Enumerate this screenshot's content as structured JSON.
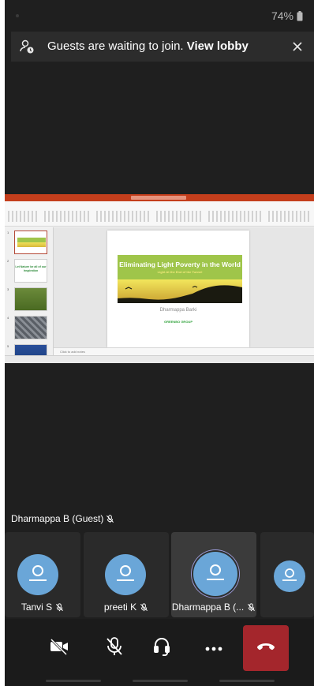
{
  "status_bar": {
    "battery_percent": "74%",
    "icons": [
      "battery-icon"
    ]
  },
  "lobby_banner": {
    "message": "Guests are waiting to join.",
    "link_label": "View lobby",
    "icons": [
      "guest-waiting-icon",
      "close-icon"
    ]
  },
  "shared_screen": {
    "app": "PowerPoint",
    "slide": {
      "title": "Eliminating Light Poverty in the World",
      "subtitle": "Light At the End of the Tunnel",
      "author": "Dharmappa Barki",
      "organization": "GREENBO GROUP"
    },
    "thumbnails": [
      {
        "number": "1"
      },
      {
        "number": "2",
        "text": "Let Nature be all of our Inspiration"
      },
      {
        "number": "3"
      },
      {
        "number": "4"
      },
      {
        "number": "5"
      }
    ],
    "notes_placeholder": "Click to add notes"
  },
  "active_speaker": {
    "name": "Dharmappa B (Guest)",
    "muted": true
  },
  "participants": [
    {
      "name": "Tanvi S",
      "muted": true
    },
    {
      "name": "preeti K",
      "muted": true
    },
    {
      "name": "Dharmappa B (...",
      "muted": true,
      "active": true
    },
    {
      "name": "",
      "muted": false
    }
  ],
  "controls": {
    "items": [
      {
        "name": "camera-toggle",
        "icon": "video-off-icon",
        "state": "off"
      },
      {
        "name": "mic-toggle",
        "icon": "mic-off-icon",
        "state": "muted"
      },
      {
        "name": "audio-device",
        "icon": "headset-icon"
      },
      {
        "name": "more-options",
        "icon": "more-icon"
      },
      {
        "name": "end-call",
        "icon": "hang-up-icon",
        "color": "#a4262c"
      }
    ]
  },
  "colors": {
    "background": "#1f1f1f",
    "banner": "#2c2c2c",
    "avatar": "#6aa6d8",
    "end_call": "#a4262c",
    "slide_banner": "#9fc54a",
    "ppt_accent": "#c43e1c"
  }
}
